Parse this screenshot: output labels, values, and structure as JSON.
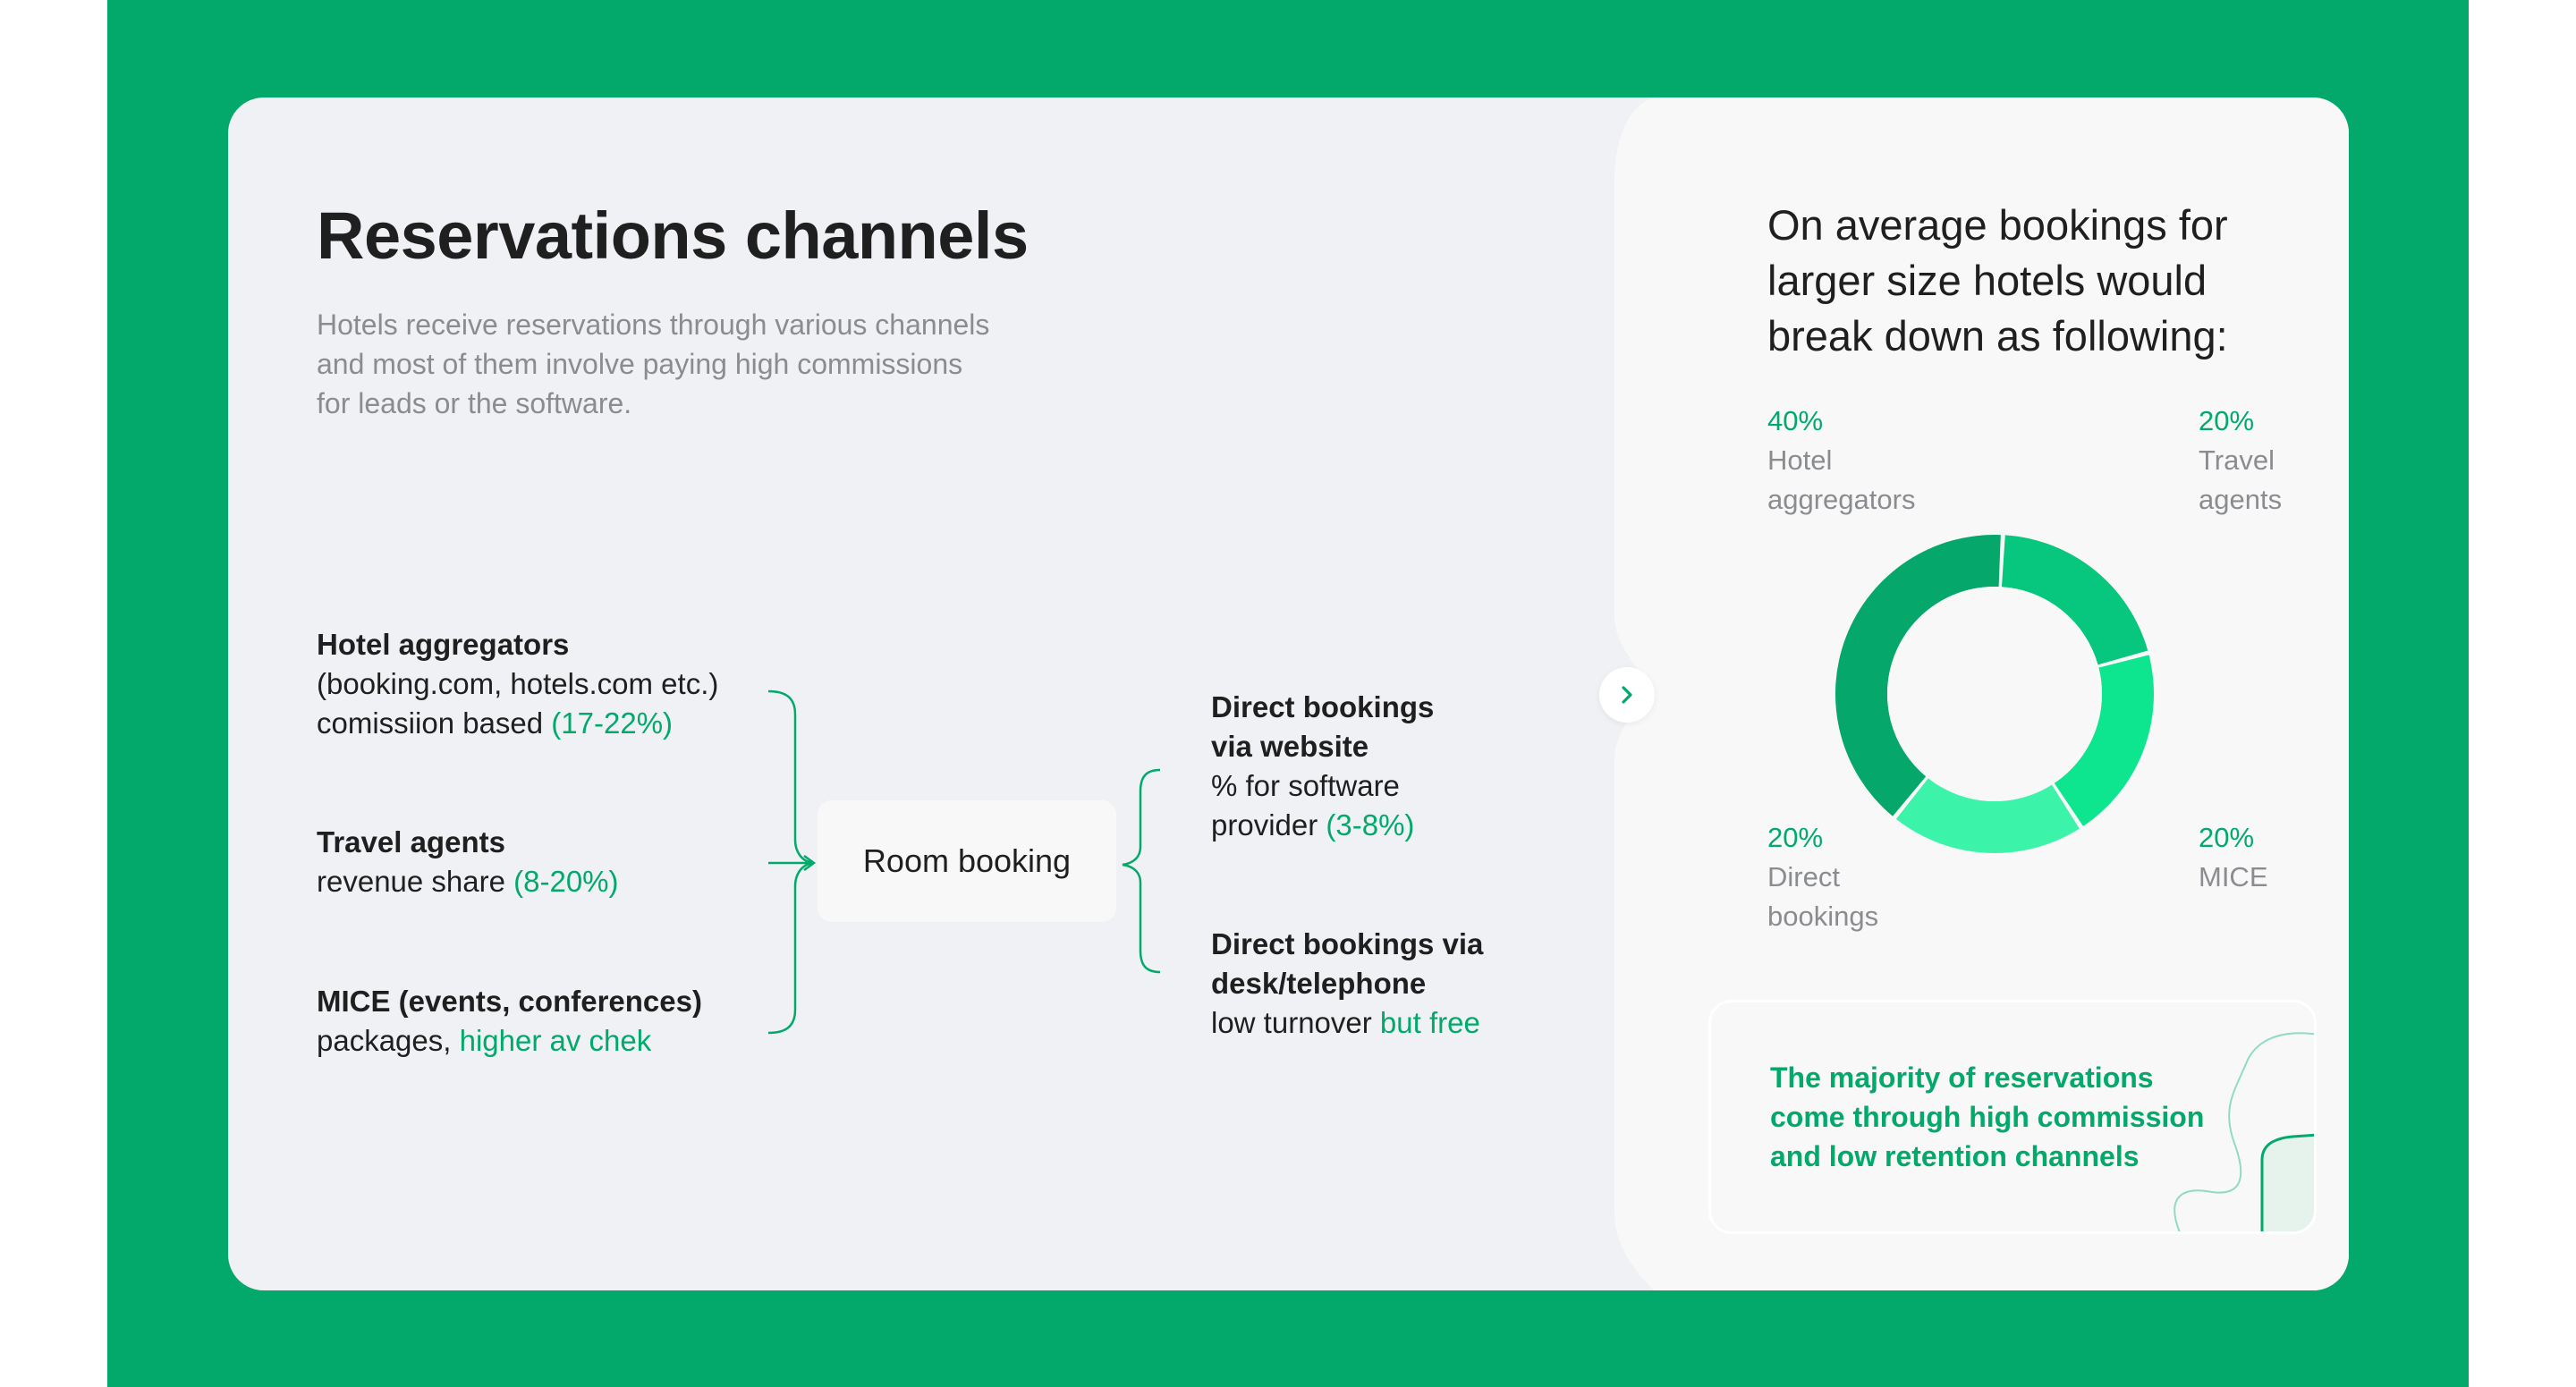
{
  "title": "Reservations channels",
  "subtitle": "Hotels receive reservations through various channels and most of them involve paying high commissions for leads or the software.",
  "sources": [
    {
      "name": "Hotel aggregators",
      "line1": "(booking.com, hotels.com etc.)",
      "line2_prefix": "comissiion based ",
      "line2_accent": "(17-22%)"
    },
    {
      "name": "Travel agents",
      "line2_prefix": "revenue share ",
      "line2_accent": "(8-20%)"
    },
    {
      "name": "MICE (events, conferences)",
      "line2_prefix": "packages, ",
      "line2_accent": "higher av chek"
    }
  ],
  "center_node": "Room booking",
  "outputs": [
    {
      "name_line1": "Direct bookings",
      "name_line2": "via website",
      "line1": "% for software",
      "line2_prefix": "provider ",
      "line2_accent": "(3-8%)"
    },
    {
      "name_line1": "Direct bookings via",
      "name_line2": "desk/telephone",
      "line2_prefix": "low turnover ",
      "line2_accent": "but free"
    }
  ],
  "arrow_icon": "chevron-right-icon",
  "right_title": "On average bookings for larger size hotels would break down as following:",
  "chart_data": {
    "type": "pie",
    "variant": "donut",
    "categories": [
      "Hotel aggregators",
      "Travel agents",
      "MICE",
      "Direct bookings"
    ],
    "values": [
      40,
      20,
      20,
      20
    ],
    "value_labels": [
      "40%",
      "20%",
      "20%",
      "20%"
    ],
    "label_lines": [
      [
        "Hotel",
        "aggregators"
      ],
      [
        "Travel",
        "agents"
      ],
      [
        "MICE"
      ],
      [
        "Direct",
        "bookings"
      ]
    ],
    "colors": [
      "#05a86a",
      "#07c67d",
      "#0de68e",
      "#3bf3a9"
    ]
  },
  "note": "The majority of reservations come through high commission and low retention channels",
  "colors": {
    "brand_green": "#02a96b",
    "card_bg": "#f0f1f4",
    "panel_bg": "#f8f8f9",
    "muted_text": "#8a8c90",
    "dark_text": "#1f1f1f"
  }
}
